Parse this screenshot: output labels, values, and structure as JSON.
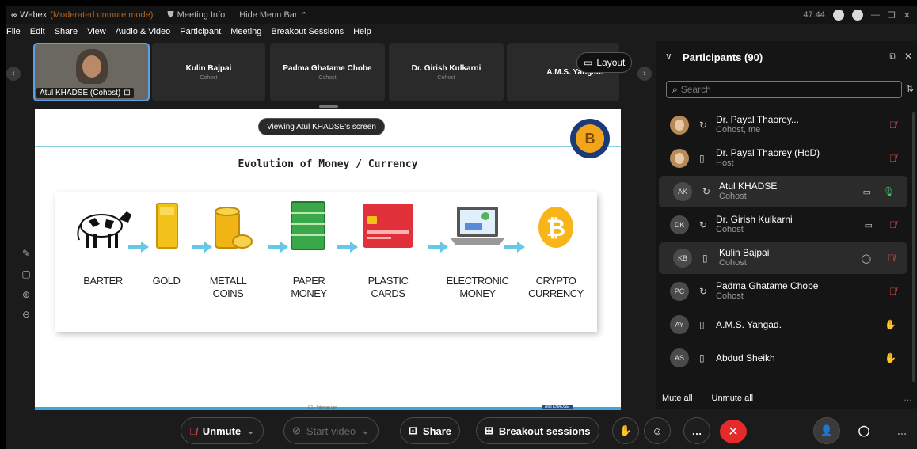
{
  "titlebar": {
    "app": "Webex",
    "mode": "(Moderated unmute mode)",
    "meeting_info": "Meeting Info",
    "hide_menu": "Hide Menu Bar",
    "timer": "47:44"
  },
  "menu": [
    "File",
    "Edit",
    "Share",
    "View",
    "Audio & Video",
    "Participant",
    "Meeting",
    "Breakout Sessions",
    "Help"
  ],
  "strip": {
    "self_label": "Atul KHADSE (Cohost)",
    "tiles": [
      {
        "name": "Kulin Bajpai",
        "role": "Cohost"
      },
      {
        "name": "Padma Ghatame Chobe",
        "role": "Cohost"
      },
      {
        "name": "Dr. Girish Kulkarni",
        "role": "Cohost"
      },
      {
        "name": "A.M.S. Yangad.",
        "role": ""
      }
    ],
    "layout_label": "Layout"
  },
  "share": {
    "viewing": "Viewing Atul KHADSE's screen",
    "slide_title": "Evolution of Money / Currency",
    "stages": [
      {
        "l1": "BARTER",
        "l2": ""
      },
      {
        "l1": "GOLD",
        "l2": ""
      },
      {
        "l1": "METALL",
        "l2": "COINS"
      },
      {
        "l1": "PAPER",
        "l2": "MONEY"
      },
      {
        "l1": "PLASTIC",
        "l2": "CARDS"
      },
      {
        "l1": "ELECTRONIC",
        "l2": "MONEY"
      },
      {
        "l1": "CRYPTO",
        "l2": "CURRENCY"
      }
    ],
    "footer": "C1 - Internal use",
    "footer_name": "Atul KHADSE"
  },
  "panel": {
    "title": "Participants (90)",
    "search_placeholder": "Search",
    "participants": [
      {
        "name": "Dr. Payal Thaorey...",
        "role": "Cohost, me",
        "avatar": "",
        "device": "sync",
        "mic": "muted",
        "cam": false
      },
      {
        "name": "Dr. Payal Thaorey (HoD)",
        "role": "Host",
        "avatar": "",
        "device": "phone",
        "mic": "muted",
        "cam": false
      },
      {
        "name": "Atul KHADSE",
        "role": "Cohost",
        "avatar": "AK",
        "device": "sync",
        "mic": "on",
        "cam": true
      },
      {
        "name": "Dr. Girish Kulkarni",
        "role": "Cohost",
        "avatar": "DK",
        "device": "sync",
        "mic": "muted",
        "cam": true
      },
      {
        "name": "Kulin Bajpai",
        "role": "Cohost",
        "avatar": "KB",
        "device": "phone",
        "mic": "muted",
        "cam": false
      },
      {
        "name": "Padma Ghatame Chobe",
        "role": "Cohost",
        "avatar": "PC",
        "device": "sync",
        "mic": "muted",
        "cam": false
      },
      {
        "name": "A.M.S. Yangad.",
        "role": "",
        "avatar": "AY",
        "device": "phone",
        "mic": "raise",
        "cam": false
      },
      {
        "name": "Abdud Sheikh",
        "role": "",
        "avatar": "AS",
        "device": "phone",
        "mic": "raise",
        "cam": false
      }
    ],
    "mute_all": "Mute all",
    "unmute_all": "Unmute all"
  },
  "controls": {
    "unmute": "Unmute",
    "start_video": "Start video",
    "share": "Share",
    "breakout": "Breakout sessions"
  }
}
